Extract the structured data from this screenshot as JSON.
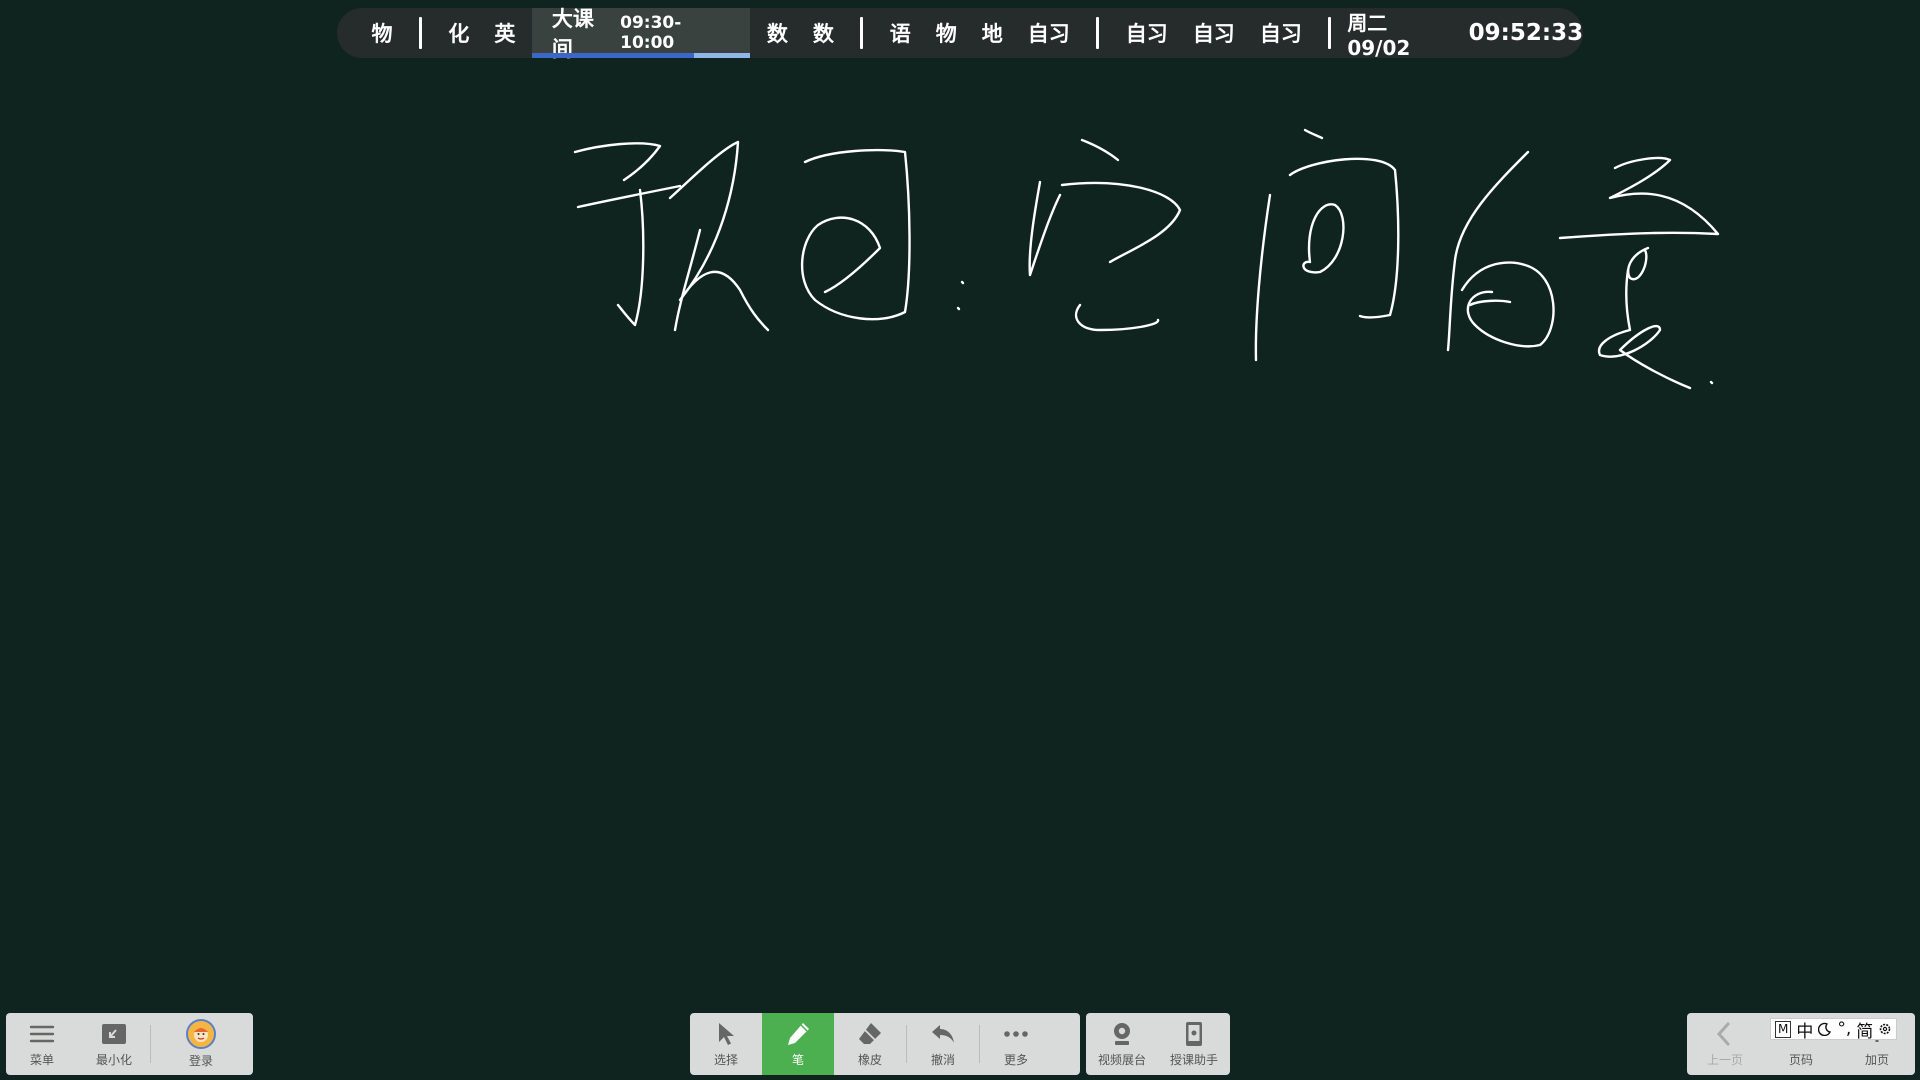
{
  "schedule": {
    "periods_a": [
      "物",
      "化",
      "英"
    ],
    "current": {
      "label": "大课间",
      "time": "09:30-10:00",
      "progress": 0.74
    },
    "periods_b": [
      "数",
      "数"
    ],
    "periods_c": [
      "语",
      "物",
      "地",
      "自习"
    ],
    "periods_d": [
      "自习",
      "自习",
      "自习"
    ],
    "date": "周二 09/02",
    "clock": "09:52:33"
  },
  "board": {
    "background_color": "#10241f",
    "ink_color": "#ffffff",
    "handwriting_text": "预习: 空间向量"
  },
  "left_toolbar": {
    "menu_label": "菜单",
    "minimize_label": "最小化",
    "login_label": "登录"
  },
  "center_toolbar": {
    "select_label": "选择",
    "pen_label": "笔",
    "eraser_label": "橡皮",
    "undo_label": "撤消",
    "more_label": "更多",
    "active_tool": "pen",
    "active_color": "#4caf50"
  },
  "media_toolbar": {
    "visualizer_label": "视频展台",
    "assistant_label": "授课助手"
  },
  "right_toolbar": {
    "prev_label": "上一页",
    "page_label": "页码",
    "add_page_label": "加页"
  },
  "ime": {
    "mode": "M",
    "lang": "中",
    "punct": "°,",
    "script": "简"
  }
}
